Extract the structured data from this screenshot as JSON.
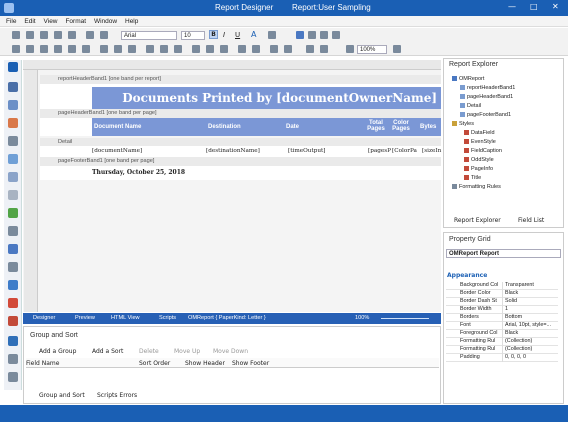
{
  "window": {
    "title": "Report Designer",
    "subtitle": "Report:User Sampling"
  },
  "menu": [
    "File",
    "Edit",
    "View",
    "Format",
    "Window",
    "Help"
  ],
  "toolbar": {
    "font": "Arial",
    "size": "10",
    "zoom": "100%"
  },
  "bands": {
    "reportHeader": "reportHeaderBand1 [one band per report]",
    "pageHeader": "pageHeaderBand1 [one band per page]",
    "detail": "Detail",
    "pageFooter": "pageFooterBand1 [one band per page]"
  },
  "report": {
    "title": "Documents Printed by [documentOwnerName]",
    "columns": [
      "Document Name",
      "Destination",
      "Date",
      "Total Pages",
      "Color Pages",
      "Bytes"
    ],
    "detail_fields": [
      "[documentName]",
      "[destinationName]",
      "[timeOutput]",
      "[pagesP",
      "[ColorPa",
      "[sizeIn"
    ],
    "footer_date": "Thursday, October 25, 2018"
  },
  "designer_tabs": [
    "Designer",
    "Preview",
    "HTML View",
    "Scripts"
  ],
  "status": {
    "report": "OMReport { PaperKind: Letter }",
    "zoom": "100%"
  },
  "group_sort": {
    "title": "Group and Sort",
    "buttons": [
      "Add a Group",
      "Add a Sort",
      "Delete",
      "Move Up",
      "Move Down"
    ],
    "columns": [
      "Field Name",
      "Sort Order",
      "Show Header",
      "Show Footer"
    ],
    "tabs": [
      "Group and Sort",
      "Scripts Errors"
    ]
  },
  "report_explorer": {
    "title": "Report Explorer",
    "items": [
      "OMReport",
      "reportHeaderBand1",
      "pageHeaderBand1",
      "Detail",
      "pageFooterBand1",
      "Styles",
      "DataField",
      "EvenStyle",
      "FieldCaption",
      "OddStyle",
      "PageInfo",
      "Title",
      "Formatting Rules"
    ],
    "tabs": [
      "Report Explorer",
      "Field List"
    ]
  },
  "property_grid": {
    "title": "Property Grid",
    "selector": "OMReport  Report",
    "category": "Appearance",
    "props": [
      {
        "n": "Background Col",
        "v": "Transparent"
      },
      {
        "n": "Border Color",
        "v": "Black"
      },
      {
        "n": "Border Dash St",
        "v": "Solid"
      },
      {
        "n": "Border Width",
        "v": "1"
      },
      {
        "n": "Borders",
        "v": "Bottom"
      },
      {
        "n": "Font",
        "v": "Arial, 10pt, style=..."
      },
      {
        "n": "Foreground Col",
        "v": "Black"
      },
      {
        "n": "Formatting Rul",
        "v": "(Collection)"
      },
      {
        "n": "Formatting Rul",
        "v": "(Collection)"
      },
      {
        "n": "Padding",
        "v": "0, 0, 0, 0"
      }
    ]
  },
  "colors": {
    "accent": "#1a5fb4",
    "header": "#7b97d6"
  }
}
